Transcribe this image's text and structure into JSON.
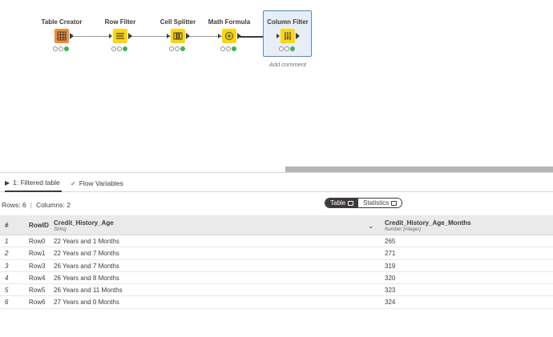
{
  "workflow": {
    "nodes": [
      {
        "title": "Table Creator",
        "color": "#ef8d3a",
        "icon": "table-creator-icon"
      },
      {
        "title": "Row Filter",
        "color": "#fdd60c",
        "icon": "row-filter-icon"
      },
      {
        "title": "Cell Splitter",
        "color": "#fdd60c",
        "icon": "cell-splitter-icon"
      },
      {
        "title": "Math Formula",
        "color": "#fdd60c",
        "icon": "math-formula-icon"
      },
      {
        "title": "Column Filter",
        "color": "#fdd60c",
        "icon": "column-filter-icon"
      }
    ],
    "add_comment": "Add comment",
    "status_color": "#3cb44b"
  },
  "tabs": [
    {
      "label": "1: Filtered table",
      "icon": "play-icon"
    },
    {
      "label": "Flow Variables",
      "icon": "flow-variables-icon"
    }
  ],
  "summary": {
    "rows": "Rows: 6",
    "sep": "|",
    "columns": "Columns: 2"
  },
  "toggle": {
    "table": "Table",
    "statistics": "Statistics"
  },
  "table": {
    "headers": {
      "index": "#",
      "rowid": "RowID",
      "col1_name": "Credit_History_Age",
      "col1_type": "String",
      "col2_name": "Credit_History_Age_Months",
      "col2_type": "Number (integer)"
    },
    "rows": [
      {
        "idx": "1",
        "rowid": "Row0",
        "age": "22 Years and 1 Months",
        "months": "265"
      },
      {
        "idx": "2",
        "rowid": "Row1",
        "age": "22 Years and 7 Months",
        "months": "271"
      },
      {
        "idx": "3",
        "rowid": "Row3",
        "age": "26 Years and 7 Months",
        "months": "319"
      },
      {
        "idx": "4",
        "rowid": "Row4",
        "age": "26 Years and 8 Months",
        "months": "320"
      },
      {
        "idx": "5",
        "rowid": "Row5",
        "age": "26 Years and 11 Months",
        "months": "323"
      },
      {
        "idx": "6",
        "rowid": "Row6",
        "age": "27 Years and 0 Months",
        "months": "324"
      }
    ]
  }
}
